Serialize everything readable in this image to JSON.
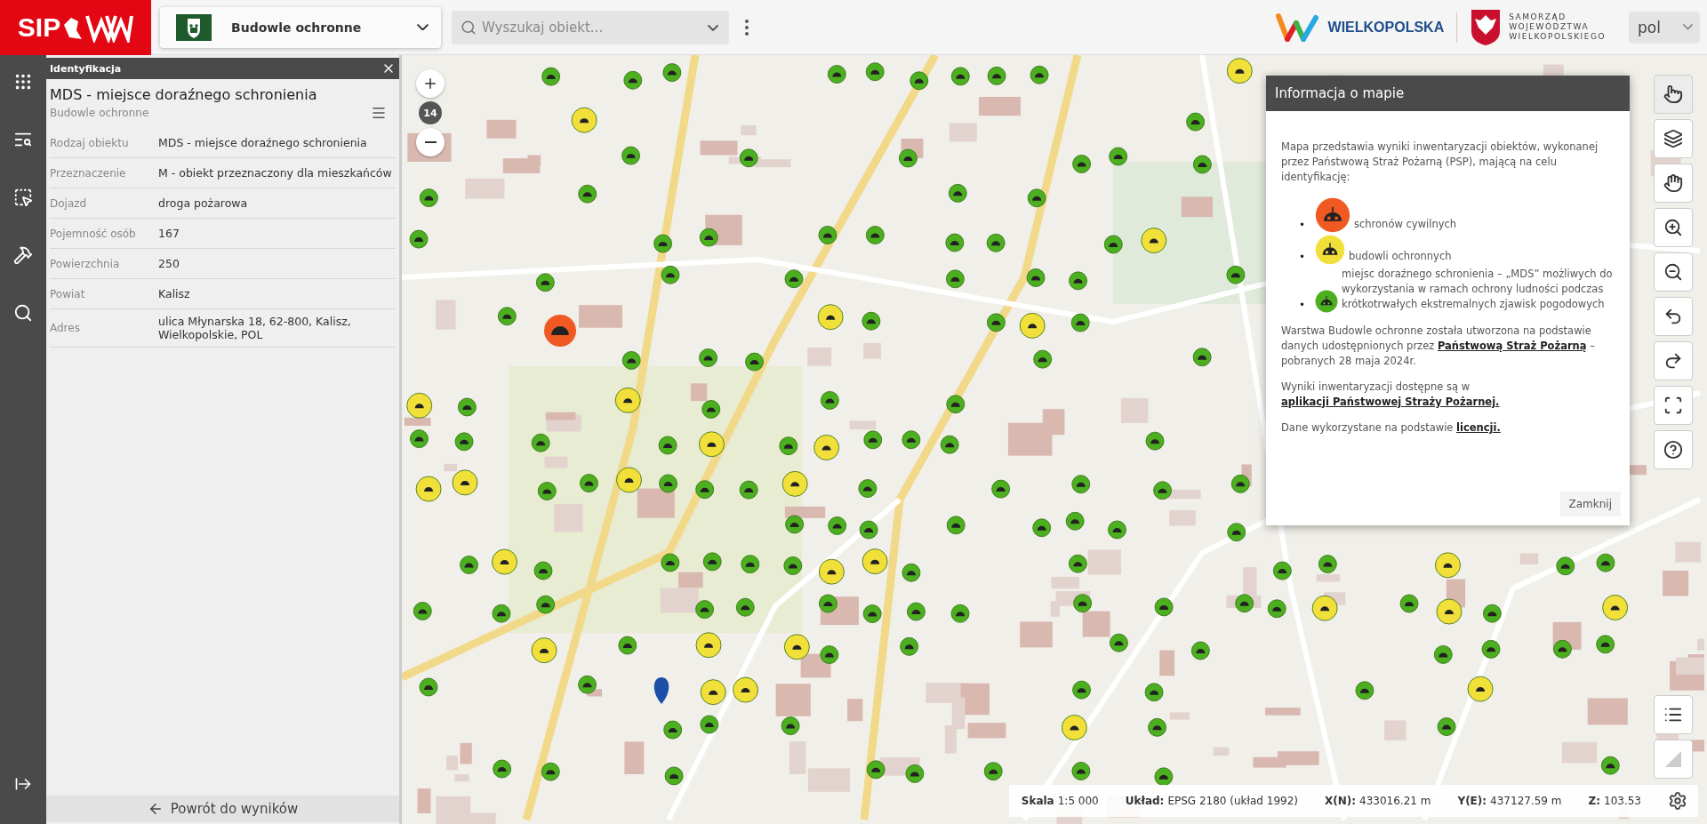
{
  "header": {
    "logo": "SIP",
    "layer_select": {
      "value": "Budowle ochronne"
    },
    "search": {
      "placeholder": "Wyszukaj obiekt..."
    },
    "region_logo": "WIELKOPOLSKA",
    "authority_logo": [
      "SAMORZĄD",
      "WOJEWÓDZTWA",
      "WIELKOPOLSKIEGO"
    ],
    "language": "pol"
  },
  "identification": {
    "title": "Identyfikacja",
    "name": "MDS - miejsce doraźnego schronienia",
    "layer": "Budowle ochronne",
    "attributes": [
      {
        "label": "Rodzaj obiektu",
        "value": "MDS - miejsce doraźnego schronienia"
      },
      {
        "label": "Przeznaczenie",
        "value": "M - obiekt przeznaczony dla mieszkańców"
      },
      {
        "label": "Dojazd",
        "value": "droga pożarowa"
      },
      {
        "label": "Pojemność osób",
        "value": "167"
      },
      {
        "label": "Powierzchnia",
        "value": "250"
      },
      {
        "label": "Powiat",
        "value": "Kalisz"
      },
      {
        "label": "Adres",
        "value": "ulica Młynarska 18, 62-800, Kalisz, Wielkopolskie, POL"
      }
    ],
    "back_button": "Powrót do wyników"
  },
  "map": {
    "zoom_level": "14"
  },
  "map_info": {
    "title": "Informacja o mapie",
    "intro": "Mapa przedstawia wyniki inwentaryzacji obiektów, wykonanej przez Państwową Straż Pożarną (PSP), mającą na celu identyfikację:",
    "legend": [
      {
        "bullet": "•",
        "kind": "large",
        "color": "#f05a22",
        "text": "schronów cywilnych"
      },
      {
        "bullet": "•",
        "kind": "medium",
        "color": "#f2e03a",
        "text": "budowli ochronnych"
      },
      {
        "bullet": "•",
        "kind": "small",
        "color": "#4caf1f",
        "text": "miejsc doraźnego schronienia – „MDS” możliwych do wykorzystania w ramach ochrony ludności podczas krótkotrwałych ekstremalnych zjawisk pogodowych"
      }
    ],
    "paragraphs": [
      [
        {
          "text": "Warstwa Budowle ochronne została utworzona na podstawie danych udostępnionych przez "
        },
        {
          "link": "Państwową Straż Pożarną"
        },
        {
          "text": " – pobranych 28 maja 2024r."
        }
      ],
      [
        {
          "text": "Wyniki inwentaryzacji dostępne są w "
        },
        {
          "link": "aplikacji Państwowej Straży Pożarnej."
        }
      ],
      [
        {
          "text": "Dane wykorzystane na podstawie "
        },
        {
          "link": "licencji."
        }
      ]
    ],
    "close_button": "Zamknij"
  },
  "status_bar": {
    "scale_label": "Skala",
    "scale": "1:5 000",
    "fields": [
      {
        "label": "Układ:",
        "value": "EPSG 2180 (układ 1992)"
      },
      {
        "label": "X(N):",
        "value": "433016.21 m"
      },
      {
        "label": "Y(E):",
        "value": "437127.59 m"
      },
      {
        "label": "Z:",
        "value": "103.53"
      }
    ]
  }
}
